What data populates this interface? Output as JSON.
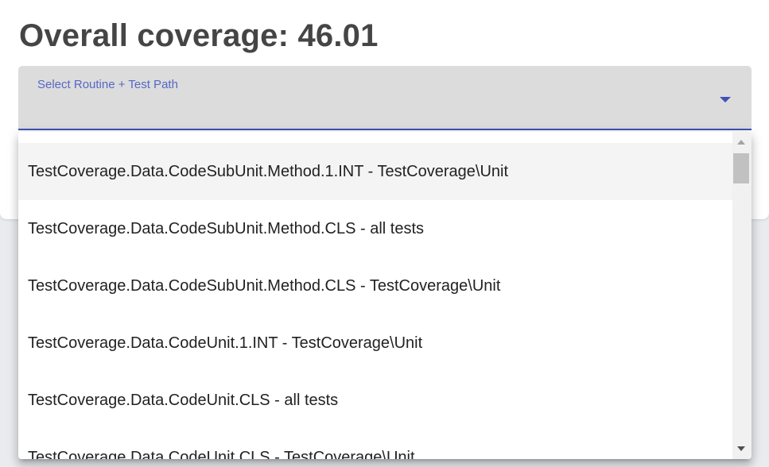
{
  "header": {
    "title": "Overall coverage: 46.01"
  },
  "select": {
    "label": "Select Routine + Test Path",
    "arrow_icon": "arrow-drop-down-icon",
    "accent_color": "#3f51b5"
  },
  "menu": {
    "items": [
      {
        "label": "TestCoverage.Data.CodeSubUnit.Method.1.INT - TestCoverage\\Unit",
        "highlighted": true
      },
      {
        "label": "TestCoverage.Data.CodeSubUnit.Method.CLS - all tests"
      },
      {
        "label": "TestCoverage.Data.CodeSubUnit.Method.CLS - TestCoverage\\Unit"
      },
      {
        "label": "TestCoverage.Data.CodeUnit.1.INT - TestCoverage\\Unit"
      },
      {
        "label": "TestCoverage.Data.CodeUnit.CLS - all tests"
      },
      {
        "label": "TestCoverage.Data.CodeUnit.CLS - TestCoverage\\Unit"
      }
    ]
  },
  "scrollbar": {
    "up_icon": "scroll-up-arrow-icon",
    "down_icon": "scroll-down-arrow-icon"
  }
}
